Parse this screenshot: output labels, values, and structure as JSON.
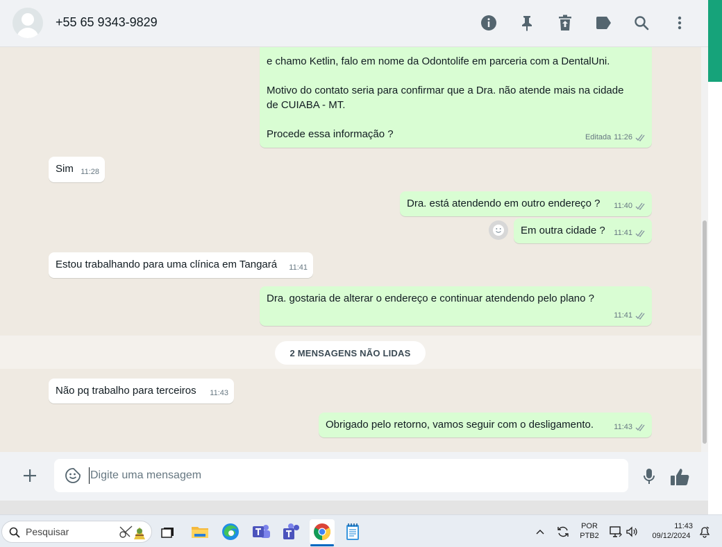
{
  "header": {
    "contact": "+55 65 9343-9829",
    "icons": [
      "info-icon",
      "pin-icon",
      "delete-icon",
      "label-icon",
      "search-icon",
      "menu-icon"
    ]
  },
  "messages": [
    {
      "dir": "out",
      "lines": [
        "e chamo Ketlin, falo em nome da Odontolife em parceria com a DentalUni.",
        "",
        "Motivo do contato seria para confirmar que a Dra. não atende mais na cidade",
        "de CUIABA - MT.",
        "",
        "Procede essa informação ?"
      ],
      "edited": "Editada",
      "time": "11:26"
    },
    {
      "dir": "in",
      "text": "Sim",
      "time": "11:28"
    },
    {
      "dir": "out",
      "text": "Dra. está atendendo em outro endereço ?",
      "time": "11:40"
    },
    {
      "dir": "out",
      "text": "Em outra cidade ?",
      "time": "11:41"
    },
    {
      "dir": "in",
      "text": "Estou trabalhando para uma clínica em Tangará",
      "time": "11:41"
    },
    {
      "dir": "out",
      "text": "Dra. gostaria de alterar o endereço e continuar atendendo pelo plano ?",
      "time": "11:41"
    },
    {
      "dir": "in",
      "text": "Não pq trabalho para terceiros",
      "time": "11:43"
    },
    {
      "dir": "out",
      "text": "Obrigado pelo retorno, vamos seguir com o desligamento.",
      "time": "11:43"
    }
  ],
  "unread_banner": "2 MENSAGENS NÃO LIDAS",
  "composer": {
    "placeholder": "Digite uma mensagem"
  },
  "taskbar": {
    "search_label": "Pesquisar",
    "lang_top": "POR",
    "lang_bottom": "PTB2",
    "time": "11:43",
    "date": "09/12/2024"
  },
  "colors": {
    "outgoing": "#d9fdd3",
    "incoming": "#ffffff",
    "chat_bg": "#efeae2",
    "ticks": "#8696a0",
    "accent": "#16a37a"
  }
}
